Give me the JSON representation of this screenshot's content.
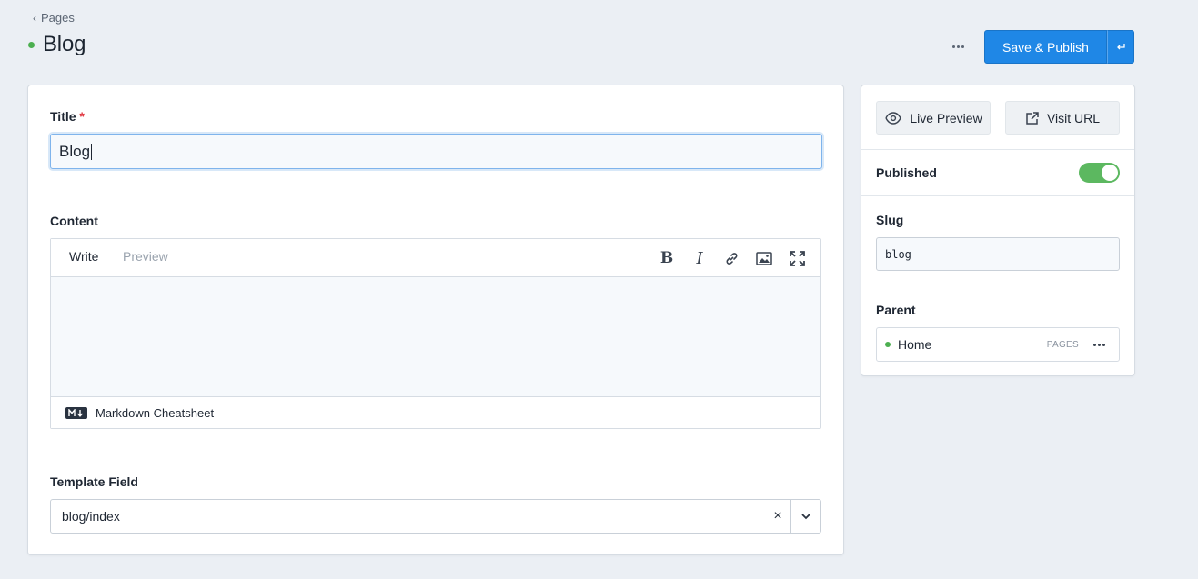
{
  "breadcrumb": {
    "label": "Pages"
  },
  "page": {
    "title": "Blog",
    "status_color": "#4caf50"
  },
  "header": {
    "more_icon": "ellipsis-icon",
    "publish_label": "Save & Publish",
    "publish_dropdown_icon": "return-arrow-icon",
    "accent": "#1f87e6"
  },
  "fields": {
    "title": {
      "label": "Title",
      "required_mark": "*",
      "value": "Blog"
    },
    "content": {
      "label": "Content",
      "tabs": [
        "Write",
        "Preview"
      ],
      "toolbar": {
        "bold": "B",
        "italic": "I",
        "icons": [
          "bold-icon",
          "italic-icon",
          "link-icon",
          "image-icon",
          "fullscreen-icon"
        ]
      },
      "footer_label": "Markdown Cheatsheet"
    },
    "template": {
      "label": "Template Field",
      "value": "blog/index",
      "clear": "×"
    }
  },
  "sidebar": {
    "live_preview_label": "Live Preview",
    "visit_url_label": "Visit URL",
    "published_label": "Published",
    "published": true,
    "slug_label": "Slug",
    "slug_value": "blog",
    "parent_label": "Parent",
    "parent": {
      "name": "Home",
      "collection": "PAGES"
    }
  }
}
